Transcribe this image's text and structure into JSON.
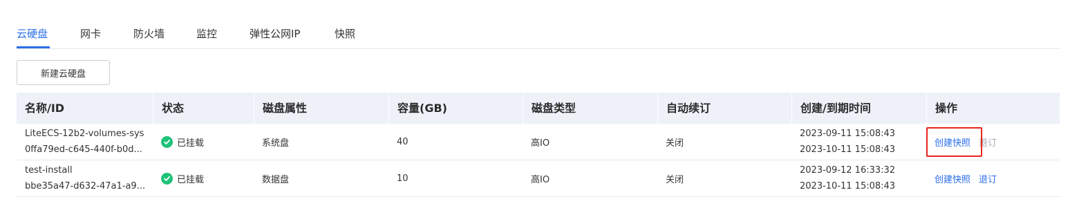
{
  "tabs": [
    {
      "label": "云硬盘",
      "active": true
    },
    {
      "label": "网卡",
      "active": false
    },
    {
      "label": "防火墙",
      "active": false
    },
    {
      "label": "监控",
      "active": false
    },
    {
      "label": "弹性公网IP",
      "active": false
    },
    {
      "label": "快照",
      "active": false
    }
  ],
  "toolbar": {
    "new_disk_label": "新建云硬盘"
  },
  "table": {
    "headers": [
      "名称/ID",
      "状态",
      "磁盘属性",
      "容量(GB)",
      "磁盘类型",
      "自动续订",
      "创建/到期时间",
      "操作"
    ],
    "rows": [
      {
        "name": "LiteECS-12b2-volumes-sys",
        "id": "0ffa79ed-c645-440f-b0d...",
        "status": "已挂载",
        "attribute": "系统盘",
        "capacity": "40",
        "disk_type": "高IO",
        "auto_renew": "关闭",
        "created": "2023-09-11 15:08:43",
        "expires": "2023-10-11 15:08:43",
        "action_primary": "创建快照",
        "action_secondary": "退订",
        "action_secondary_disabled": true
      },
      {
        "name": "test-install",
        "id": "bbe35a47-d632-47a1-a9...",
        "status": "已挂载",
        "attribute": "数据盘",
        "capacity": "10",
        "disk_type": "高IO",
        "auto_renew": "关闭",
        "created": "2023-09-12 16:33:32",
        "expires": "2023-10-11 15:08:43",
        "action_primary": "创建快照",
        "action_secondary": "退订",
        "action_secondary_disabled": false
      }
    ]
  },
  "colors": {
    "accent": "#2a6ee8",
    "status_ok": "#1fc27a",
    "header_bg": "#eef1f8",
    "highlight": "#e8241f",
    "disabled_text": "#a8abb3"
  },
  "icons": {
    "status_ok": "check-circle-icon"
  }
}
